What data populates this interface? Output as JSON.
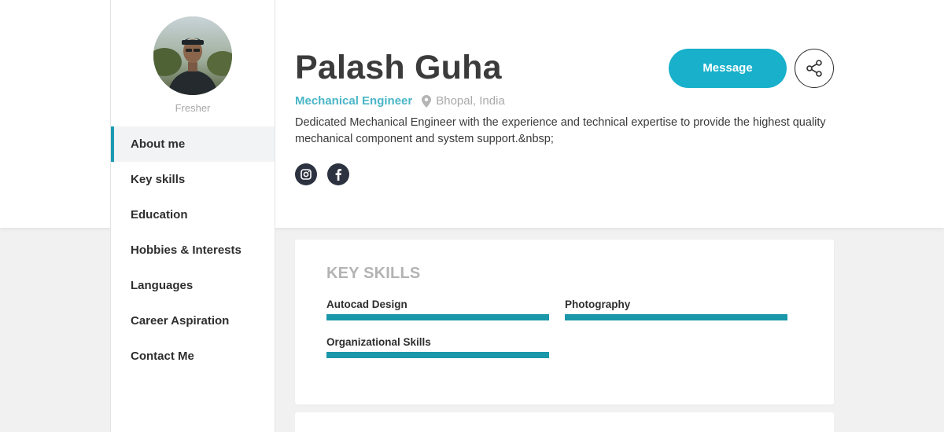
{
  "profile": {
    "name": "Palash Guha",
    "job_title": "Mechanical Engineer",
    "location": "Bhopal, India",
    "bio": "Dedicated Mechanical Engineer with the experience and technical expertise to provide the highest quality mechanical component and system support.&nbsp;",
    "status": "Fresher",
    "socials": [
      {
        "icon": "instagram-icon"
      },
      {
        "icon": "facebook-icon"
      }
    ]
  },
  "actions": {
    "message_label": "Message",
    "share_icon": "share-icon"
  },
  "sidebar": {
    "items": [
      {
        "label": "About me",
        "active": true
      },
      {
        "label": "Key skills",
        "active": false
      },
      {
        "label": "Education",
        "active": false
      },
      {
        "label": "Hobbies & Interests",
        "active": false
      },
      {
        "label": "Languages",
        "active": false
      },
      {
        "label": "Career Aspiration",
        "active": false
      },
      {
        "label": "Contact Me",
        "active": false
      }
    ]
  },
  "skills": {
    "heading": "KEY SKILLS",
    "items": [
      {
        "name": "Autocad Design",
        "level": 1.0
      },
      {
        "name": "Photography",
        "level": 1.0
      },
      {
        "name": "Organizational Skills",
        "level": 1.0
      }
    ]
  },
  "colors": {
    "accent": "#18b0cb",
    "skill_bar": "#1a97a9",
    "job_title": "#4ab6c7",
    "social_bg": "#2d3240"
  }
}
